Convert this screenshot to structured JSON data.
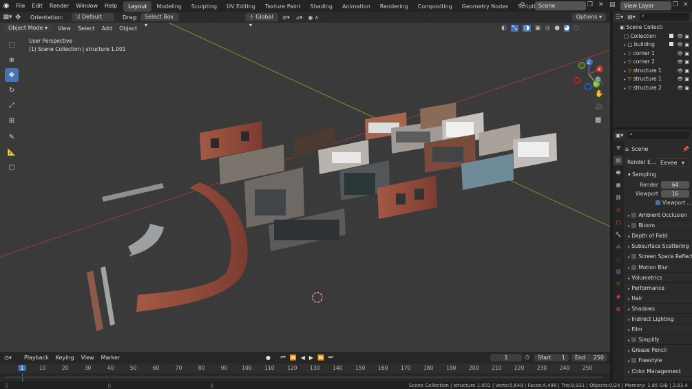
{
  "topbar": {
    "menus": [
      "File",
      "Edit",
      "Render",
      "Window",
      "Help"
    ],
    "workspaces": [
      "Layout",
      "Modeling",
      "Sculpting",
      "UV Editing",
      "Texture Paint",
      "Shading",
      "Animation",
      "Rendering",
      "Compositing",
      "Geometry Nodes",
      "Scripting"
    ],
    "active_workspace": "Layout",
    "scene": "Scene",
    "view_layer": "View Layer"
  },
  "header": {
    "orientation_label": "Orientation:",
    "orientation_value": "Default",
    "drag_label": "Drag:",
    "drag_value": "Select Box",
    "transform": "Global",
    "options": "Options",
    "mode": "Object Mode",
    "menus": [
      "View",
      "Select",
      "Add",
      "Object"
    ]
  },
  "viewport": {
    "perspective": "User Perspective",
    "collection_info": "(1) Scene Collection | structure 1.001",
    "gizmo_axes": [
      "X",
      "Y",
      "Z"
    ]
  },
  "timeline": {
    "menus": [
      "Playback",
      "Keying",
      "View",
      "Marker"
    ],
    "current_frame": "1",
    "start_label": "Start",
    "start": "1",
    "end_label": "End",
    "end": "250",
    "ruler": [
      "1",
      "10",
      "20",
      "30",
      "40",
      "50",
      "60",
      "70",
      "80",
      "90",
      "100",
      "110",
      "120",
      "130",
      "140",
      "150",
      "160",
      "170",
      "180",
      "190",
      "200",
      "210",
      "220",
      "230",
      "240",
      "250"
    ]
  },
  "status": "Scene Collection | structure 1.001 | Verts:5,649 | Faces:4,498 | Tris:8,931 | Objects:0/24 | Memory: 1.85 GiB | 2.93.4",
  "outliner": {
    "root": "Scene Collecti",
    "items": [
      {
        "name": "Collection",
        "kind": "collection"
      },
      {
        "name": "building",
        "kind": "collection"
      },
      {
        "name": "corner 1",
        "kind": "mesh"
      },
      {
        "name": "corner 2",
        "kind": "mesh"
      },
      {
        "name": "structure 1",
        "kind": "mesh"
      },
      {
        "name": "structure 1",
        "kind": "mesh"
      },
      {
        "name": "structure 2",
        "kind": "mesh"
      }
    ]
  },
  "properties": {
    "scene": "Scene",
    "render_engine_label": "Render E...",
    "render_engine": "Eevee",
    "sampling": "Sampling",
    "render_label": "Render",
    "render_samples": "64",
    "viewport_label": "Viewport",
    "viewport_samples": "16",
    "viewport_denoise": "Viewport ...",
    "panels": [
      {
        "label": "Ambient Occlusion",
        "checkbox": true
      },
      {
        "label": "Bloom",
        "checkbox": true
      },
      {
        "label": "Depth of Field",
        "checkbox": false
      },
      {
        "label": "Subsurface Scattering",
        "checkbox": false
      },
      {
        "label": "Screen Space Reflecti",
        "checkbox": true
      },
      {
        "label": "Motion Blur",
        "checkbox": true
      },
      {
        "label": "Volumetrics",
        "checkbox": false
      },
      {
        "label": "Performance",
        "checkbox": false
      },
      {
        "label": "Hair",
        "checkbox": false
      },
      {
        "label": "Shadows",
        "checkbox": false
      },
      {
        "label": "Indirect Lighting",
        "checkbox": false
      },
      {
        "label": "Film",
        "checkbox": false
      },
      {
        "label": "Simplify",
        "checkbox": true
      },
      {
        "label": "Grease Pencil",
        "checkbox": false
      },
      {
        "label": "Freestyle",
        "checkbox": true
      },
      {
        "label": "Color Management",
        "checkbox": false
      }
    ]
  },
  "colors": {
    "accent": "#4772b3",
    "x_axis": "#c0392b",
    "y_axis": "#7fb33b",
    "z_axis": "#3b73c8",
    "orange": "#e08a2c"
  }
}
